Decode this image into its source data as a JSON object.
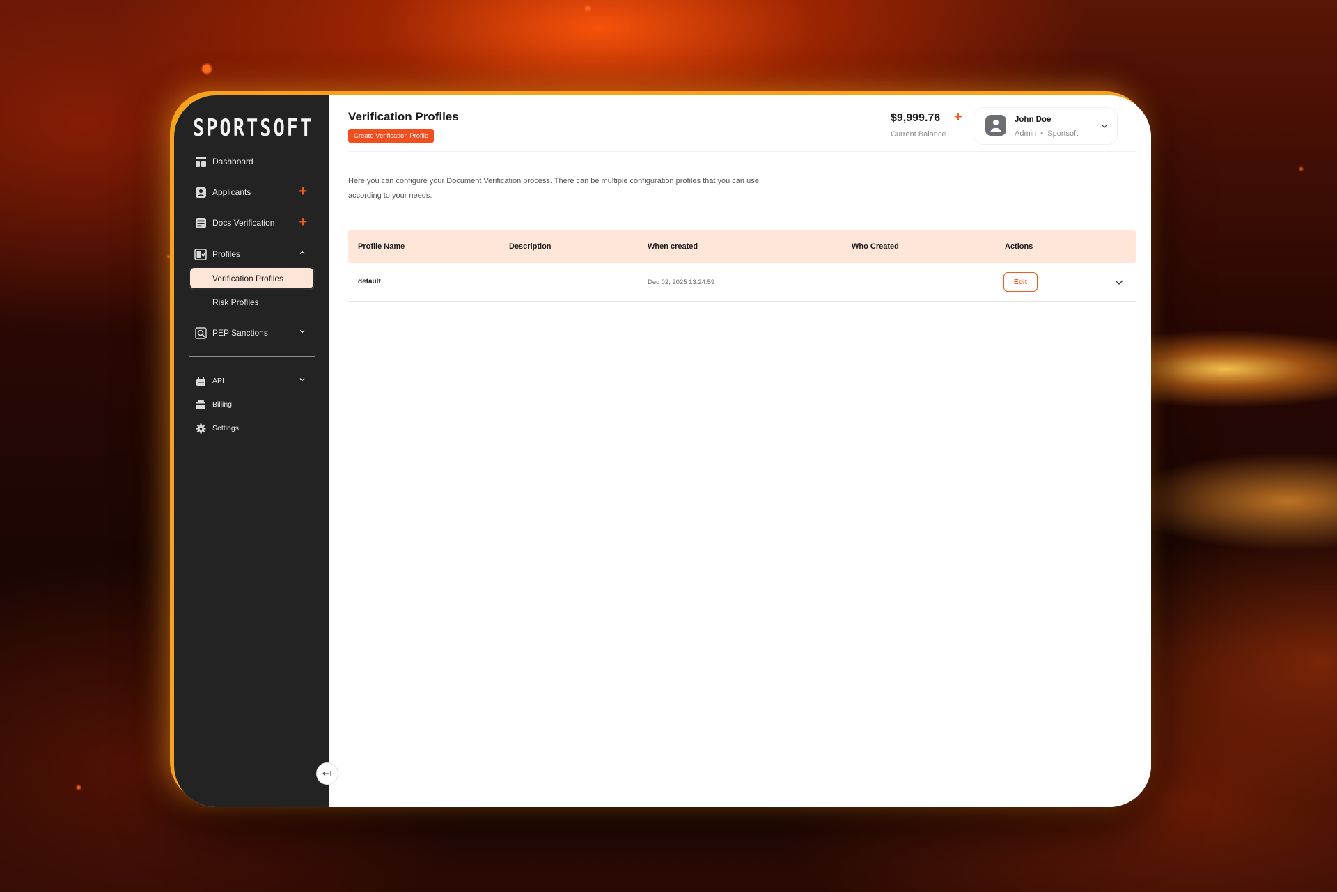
{
  "app": {
    "logo": "SPORTSOFT"
  },
  "sidebar": {
    "items": [
      {
        "label": "Dashboard",
        "icon": "dashboard-icon"
      },
      {
        "label": "Applicants",
        "icon": "applicant-icon",
        "action": "+"
      },
      {
        "label": "Docs Verification",
        "icon": "docs-icon",
        "action": "+"
      },
      {
        "label": "Profiles",
        "icon": "profiles-icon",
        "expanded": true
      },
      {
        "label": "PEP Sanctions",
        "icon": "pep-search-icon",
        "expanded": false
      }
    ],
    "profiles_children": [
      {
        "label": "Verification Profiles",
        "active": true
      },
      {
        "label": "Risk Profiles",
        "active": false
      }
    ],
    "secondary": [
      {
        "label": "API",
        "icon": "api-icon",
        "expanded": false
      },
      {
        "label": "Billing",
        "icon": "billing-icon"
      },
      {
        "label": "Settings",
        "icon": "settings-gear-icon"
      }
    ]
  },
  "header": {
    "title": "Verification Profiles",
    "create_button": "Create Verification Profile",
    "balance": "$9,999.76",
    "balance_plus": "+",
    "balance_label": "Current Balance",
    "user": {
      "name": "John Doe",
      "role": "Admin  •  Sportsoft"
    }
  },
  "description": "Here you can configure your Document Verification process. There can be multiple configuration profiles that you can use according to your needs.",
  "table": {
    "columns": [
      "Profile Name",
      "Description",
      "When created",
      "Who Created",
      "Actions"
    ],
    "rows": [
      {
        "profile_name": "default",
        "description": "",
        "when_created": "Dec 02, 2025 13:24:59",
        "who_created": "",
        "action": "Edit"
      }
    ]
  },
  "colors": {
    "accent": "#f24e1e",
    "sidebar_bg": "#232323",
    "active_item_bg": "#fde5d8",
    "table_header_bg": "#ffe6d9"
  }
}
